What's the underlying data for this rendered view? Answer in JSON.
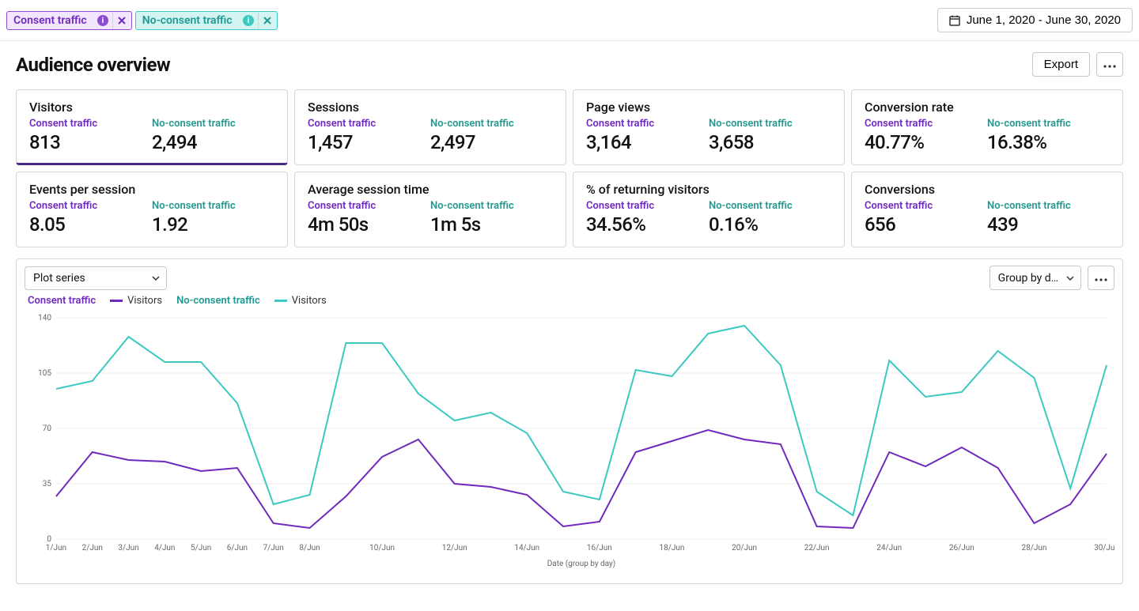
{
  "filters": {
    "consent_label": "Consent traffic",
    "noconsent_label": "No-consent traffic"
  },
  "date_range": "June 1, 2020 - June 30, 2020",
  "page_title": "Audience overview",
  "actions": {
    "export": "Export"
  },
  "segment_labels": {
    "consent": "Consent traffic",
    "noconsent": "No-consent traffic"
  },
  "cards": [
    {
      "title": "Visitors",
      "consent": "813",
      "noconsent": "2,494",
      "active": true
    },
    {
      "title": "Sessions",
      "consent": "1,457",
      "noconsent": "2,497"
    },
    {
      "title": "Page views",
      "consent": "3,164",
      "noconsent": "3,658"
    },
    {
      "title": "Conversion rate",
      "consent": "40.77%",
      "noconsent": "16.38%"
    },
    {
      "title": "Events per session",
      "consent": "8.05",
      "noconsent": "1.92"
    },
    {
      "title": "Average session time",
      "consent": "4m 50s",
      "noconsent": "1m 5s"
    },
    {
      "title": "% of returning visitors",
      "consent": "34.56%",
      "noconsent": "0.16%"
    },
    {
      "title": "Conversions",
      "consent": "656",
      "noconsent": "439"
    }
  ],
  "chart_controls": {
    "plot_series": "Plot series",
    "group_by": "Group by d…"
  },
  "legend": {
    "consent_series_text": "Consent traffic",
    "consent_metric": "Visitors",
    "noconsent_series_text": "No-consent traffic",
    "noconsent_metric": "Visitors"
  },
  "chart_data": {
    "type": "line",
    "title": "",
    "xlabel": "Date (group by day)",
    "ylabel": "",
    "ylim": [
      0,
      140
    ],
    "y_ticks": [
      0,
      35,
      70,
      105,
      140
    ],
    "categories": [
      "1/Jun",
      "2/Jun",
      "3/Jun",
      "4/Jun",
      "5/Jun",
      "6/Jun",
      "7/Jun",
      "8/Jun",
      "9/Jun",
      "10/Jun",
      "11/Jun",
      "12/Jun",
      "13/Jun",
      "14/Jun",
      "15/Jun",
      "16/Jun",
      "17/Jun",
      "18/Jun",
      "19/Jun",
      "20/Jun",
      "21/Jun",
      "22/Jun",
      "23/Jun",
      "24/Jun",
      "25/Jun",
      "26/Jun",
      "27/Jun",
      "28/Jun",
      "29/Jun",
      "30/Jun"
    ],
    "x_tick_labels": [
      "1/Jun",
      "2/Jun",
      "3/Jun",
      "4/Jun",
      "5/Jun",
      "6/Jun",
      "7/Jun",
      "8/Jun",
      "",
      "10/Jun",
      "",
      "12/Jun",
      "",
      "14/Jun",
      "",
      "16/Jun",
      "",
      "18/Jun",
      "",
      "20/Jun",
      "",
      "22/Jun",
      "",
      "24/Jun",
      "",
      "26/Jun",
      "",
      "28/Jun",
      "",
      "30/Jun"
    ],
    "series": [
      {
        "name": "Consent traffic — Visitors",
        "color": "#6f29bd",
        "values": [
          27,
          55,
          50,
          49,
          43,
          45,
          10,
          7,
          27,
          52,
          63,
          35,
          33,
          28,
          8,
          11,
          55,
          62,
          69,
          63,
          60,
          8,
          7,
          55,
          46,
          58,
          45,
          10,
          22,
          54
        ]
      },
      {
        "name": "No-consent traffic — Visitors",
        "color": "#3cc9c2",
        "values": [
          95,
          100,
          128,
          112,
          112,
          86,
          22,
          28,
          124,
          124,
          92,
          75,
          80,
          67,
          30,
          25,
          107,
          103,
          130,
          135,
          110,
          30,
          15,
          113,
          90,
          93,
          119,
          102,
          32,
          110
        ]
      }
    ]
  }
}
